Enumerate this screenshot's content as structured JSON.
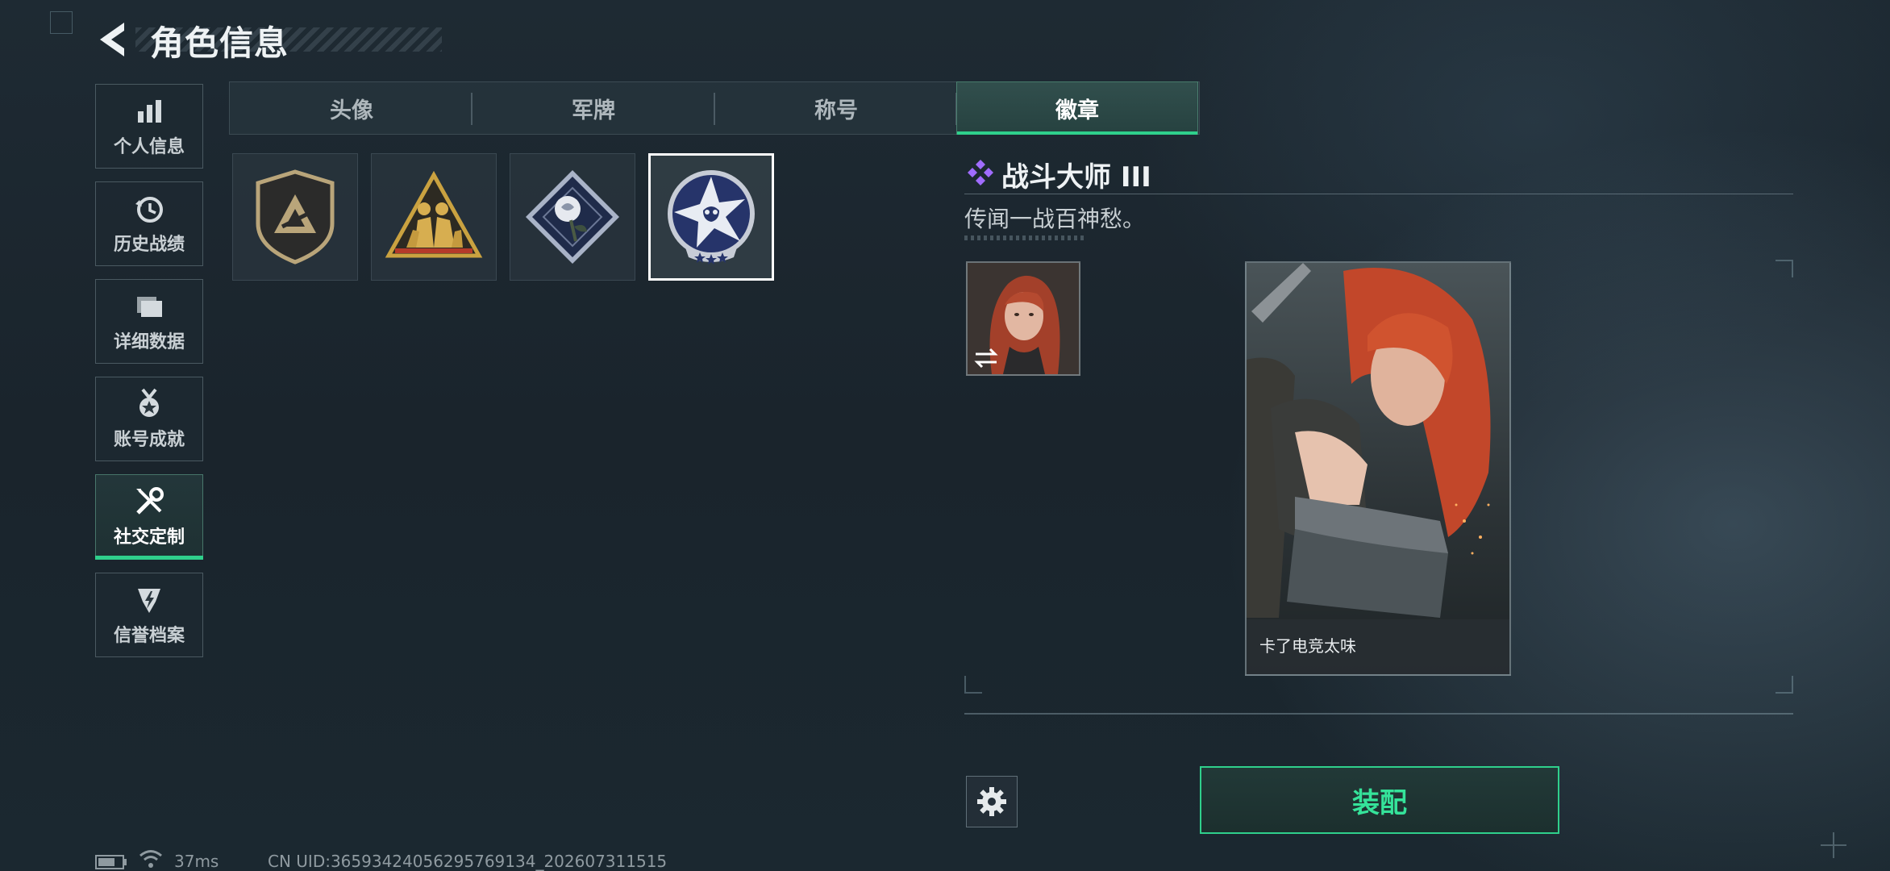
{
  "header": {
    "title": "角色信息"
  },
  "sidebar": {
    "items": [
      {
        "label": "个人信息",
        "icon": "bar-chart-icon"
      },
      {
        "label": "历史战绩",
        "icon": "history-clock-icon"
      },
      {
        "label": "详细数据",
        "icon": "folders-icon"
      },
      {
        "label": "账号成就",
        "icon": "medal-icon"
      },
      {
        "label": "社交定制",
        "icon": "tools-icon",
        "active": true
      },
      {
        "label": "信誉档案",
        "icon": "shield-lightning-icon"
      }
    ]
  },
  "tabs": [
    {
      "label": "头像"
    },
    {
      "label": "军牌"
    },
    {
      "label": "称号"
    },
    {
      "label": "徽章",
      "active": true
    }
  ],
  "badges": [
    {
      "icon": "shield-triangle-badge-icon"
    },
    {
      "icon": "soldiers-triangle-badge-icon"
    },
    {
      "icon": "rose-diamond-badge-icon"
    },
    {
      "icon": "star-skull-badge-icon",
      "selected": true
    }
  ],
  "detail": {
    "title": "战斗大师 III",
    "description": "传闻一战百神愁。",
    "rarity_icon": "purple-diamonds-icon",
    "card_name": "卡了电竞太味",
    "equip_label": "装配"
  },
  "status": {
    "ping": "37ms",
    "uid": "CN UID:3659342405629576913​4_202607311515"
  },
  "colors": {
    "accent": "#2fd08c",
    "background": "#1e2a33",
    "rarity": "#a06cff"
  }
}
